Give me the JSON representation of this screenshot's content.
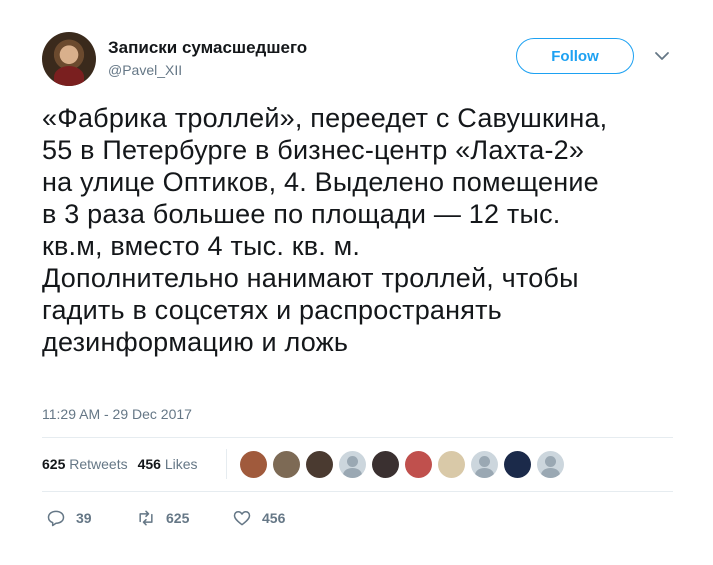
{
  "user": {
    "display_name": "Записки сумасшедшего",
    "handle": "@Pavel_XII"
  },
  "header": {
    "follow_label": "Follow"
  },
  "tweet": {
    "lines": [
      "«Фабрика троллей», переедет с Савушкина,",
      "55 в Петербурге в бизнес-центр «Лахта-2»",
      "на улице Оптиков, 4. Выделено помещение",
      "в 3 раза большее по площади — 12 тыс.",
      "кв.м, вместо 4 тыс. кв. м.",
      "Дополнительно нанимают троллей, чтобы",
      "гадить в соцсетях и распространять",
      "дезинформацию и ложь"
    ],
    "timestamp": "11:29 AM - 29 Dec 2017"
  },
  "stats": {
    "retweets_count": "625",
    "retweets_label": "Retweets",
    "likes_count": "456",
    "likes_label": "Likes"
  },
  "likers": [
    {
      "color": "#a05a3c"
    },
    {
      "color": "#7d6a55"
    },
    {
      "color": "#4a3a30"
    },
    {
      "color": "default"
    },
    {
      "color": "#3a3030"
    },
    {
      "color": "#c0504d"
    },
    {
      "color": "#d9c9a8"
    },
    {
      "color": "default"
    },
    {
      "color": "#1b2a4a"
    },
    {
      "color": "default"
    }
  ],
  "actions": {
    "replies": "39",
    "retweets": "625",
    "likes": "456"
  },
  "colors": {
    "accent": "#1da1f2",
    "muted": "#657786",
    "text": "#14171a",
    "divider": "#e6ecf0"
  }
}
